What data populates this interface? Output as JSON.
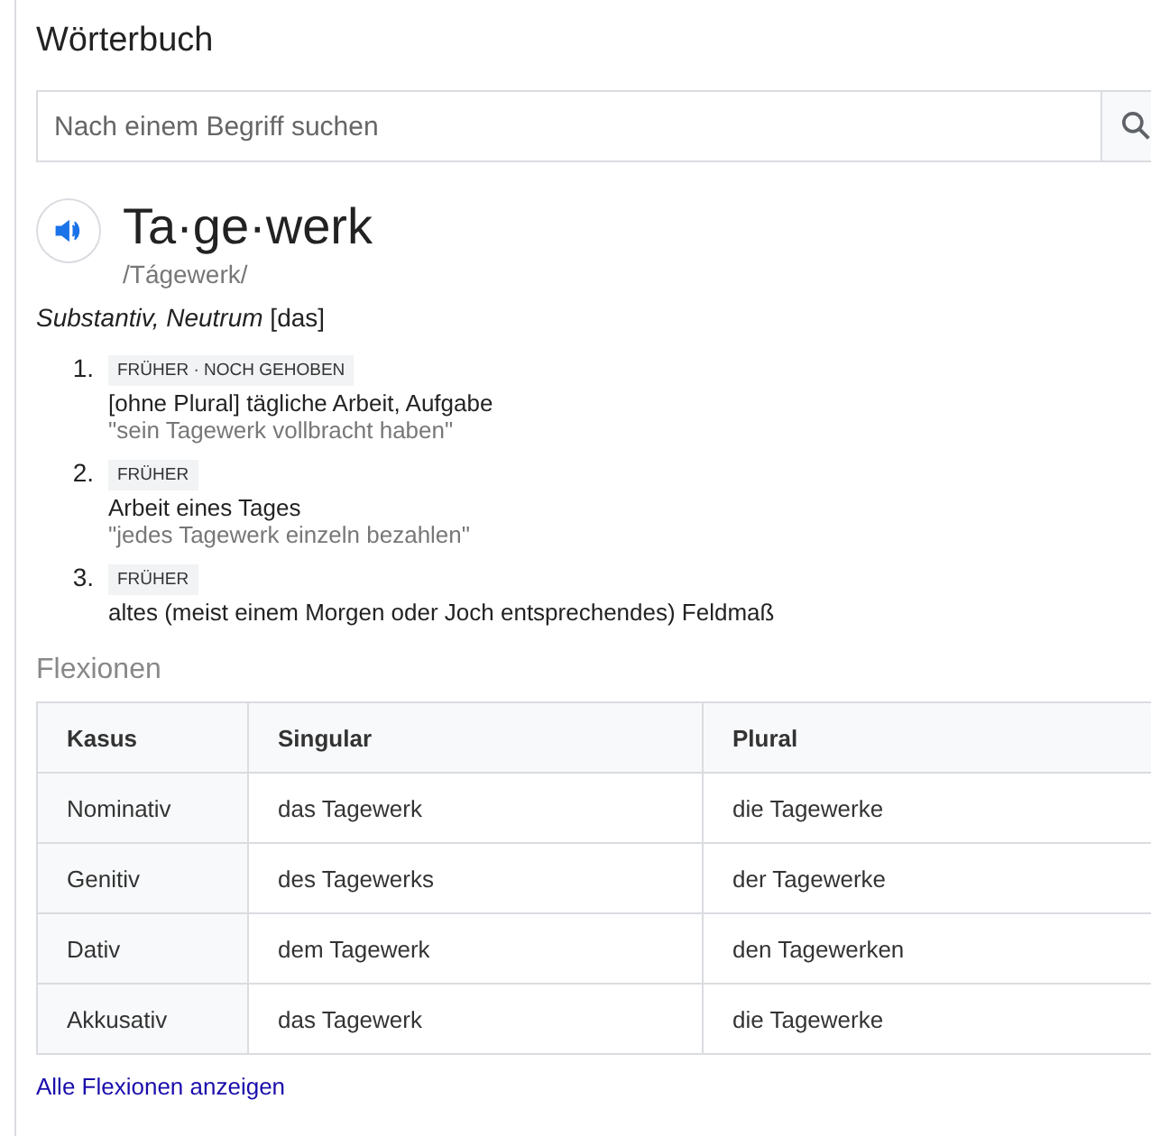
{
  "title": "Wörterbuch",
  "search": {
    "placeholder": "Nach einem Begriff suchen"
  },
  "entry": {
    "word": "Ta·ge·werk",
    "pronunciation": "/Tágewerk/",
    "grammar_italic": "Substantiv, Neutrum",
    "grammar_article": "[das]"
  },
  "senses": [
    {
      "number": "1.",
      "label": "FRÜHER · NOCH GEHOBEN",
      "definition": "[ohne Plural] tägliche Arbeit, Aufgabe",
      "example": "\"sein Tagewerk vollbracht haben\""
    },
    {
      "number": "2.",
      "label": "FRÜHER",
      "definition": "Arbeit eines Tages",
      "example": "\"jedes Tagewerk einzeln bezahlen\""
    },
    {
      "number": "3.",
      "label": "FRÜHER",
      "definition": "altes (meist einem Morgen oder Joch entsprechendes) Feldmaß"
    }
  ],
  "inflections": {
    "heading": "Flexionen",
    "columns": [
      "Kasus",
      "Singular",
      "Plural"
    ],
    "rows": [
      [
        "Nominativ",
        "das Tagewerk",
        "die Tagewerke"
      ],
      [
        "Genitiv",
        "des Tagewerks",
        "der Tagewerke"
      ],
      [
        "Dativ",
        "dem Tagewerk",
        "den Tagewerken"
      ],
      [
        "Akkusativ",
        "das Tagewerk",
        "die Tagewerke"
      ]
    ],
    "more_link": "Alle Flexionen anzeigen"
  }
}
